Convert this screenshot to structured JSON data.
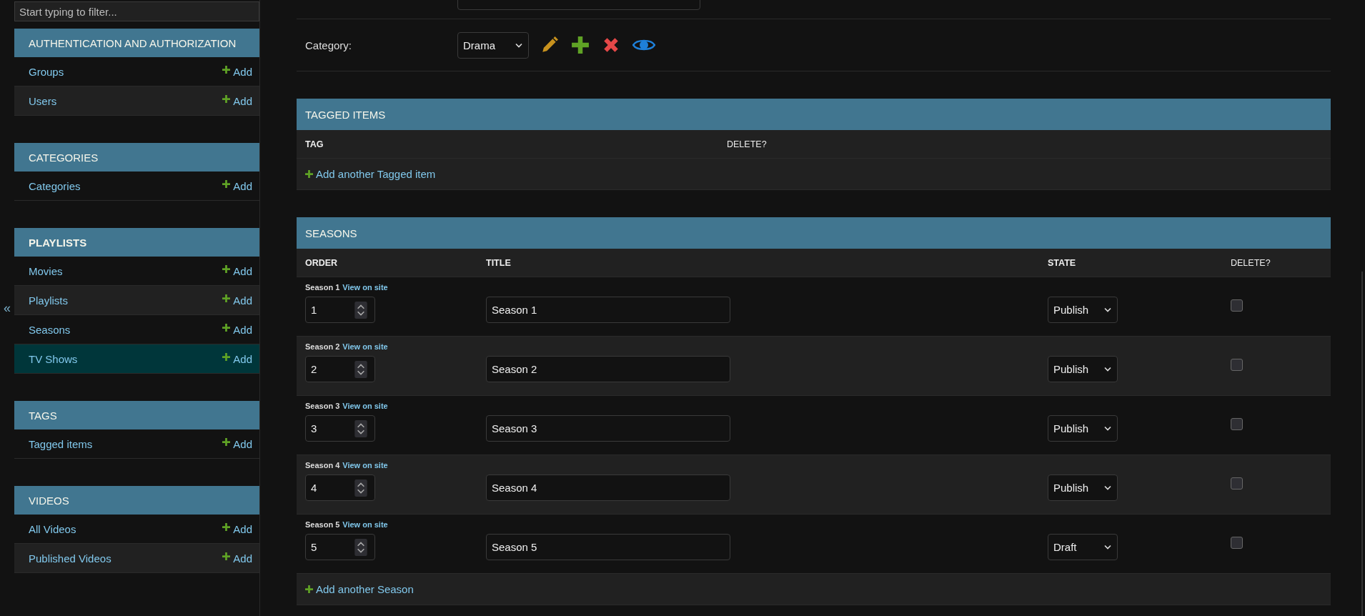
{
  "sidebar": {
    "filter_placeholder": "Start typing to filter...",
    "modules": [
      {
        "title": "AUTHENTICATION AND AUTHORIZATION",
        "current": false,
        "items": [
          {
            "name": "Groups",
            "add": "Add",
            "selected": false
          },
          {
            "name": "Users",
            "add": "Add",
            "selected": false
          }
        ]
      },
      {
        "title": "CATEGORIES",
        "current": false,
        "items": [
          {
            "name": "Categories",
            "add": "Add",
            "selected": false
          }
        ]
      },
      {
        "title": "PLAYLISTS",
        "current": true,
        "items": [
          {
            "name": "Movies",
            "add": "Add",
            "selected": false
          },
          {
            "name": "Playlists",
            "add": "Add",
            "selected": false
          },
          {
            "name": "Seasons",
            "add": "Add",
            "selected": false
          },
          {
            "name": "TV Shows",
            "add": "Add",
            "selected": true
          }
        ]
      },
      {
        "title": "TAGS",
        "current": false,
        "items": [
          {
            "name": "Tagged items",
            "add": "Add",
            "selected": false
          }
        ]
      },
      {
        "title": "VIDEOS",
        "current": false,
        "items": [
          {
            "name": "All Videos",
            "add": "Add",
            "selected": false
          },
          {
            "name": "Published Videos",
            "add": "Add",
            "selected": false
          }
        ]
      }
    ]
  },
  "sidebar_toggle": "«",
  "form": {
    "category": {
      "label": "Category:",
      "value": "Drama"
    }
  },
  "tagged_items": {
    "title": "TAGGED ITEMS",
    "columns": [
      {
        "label": "TAG",
        "kind": "bold"
      },
      {
        "label": "DELETE?",
        "kind": "plain"
      }
    ],
    "add_link": "Add another Tagged item"
  },
  "seasons": {
    "title": "SEASONS",
    "columns": [
      {
        "label": "ORDER",
        "kind": "bold"
      },
      {
        "label": "TITLE",
        "kind": "bold"
      },
      {
        "label": "STATE",
        "kind": "bold"
      },
      {
        "label": "DELETE?",
        "kind": "plain"
      }
    ],
    "rows": [
      {
        "name": "Season 1",
        "view_link": "View on site",
        "order": "1",
        "title": "Season 1",
        "state": "Publish",
        "delete": false
      },
      {
        "name": "Season 2",
        "view_link": "View on site",
        "order": "2",
        "title": "Season 2",
        "state": "Publish",
        "delete": false
      },
      {
        "name": "Season 3",
        "view_link": "View on site",
        "order": "3",
        "title": "Season 3",
        "state": "Publish",
        "delete": false
      },
      {
        "name": "Season 4",
        "view_link": "View on site",
        "order": "4",
        "title": "Season 4",
        "state": "Publish",
        "delete": false
      },
      {
        "name": "Season 5",
        "view_link": "View on site",
        "order": "5",
        "title": "Season 5",
        "state": "Draft",
        "delete": false
      }
    ],
    "add_link": "Add another Season"
  }
}
